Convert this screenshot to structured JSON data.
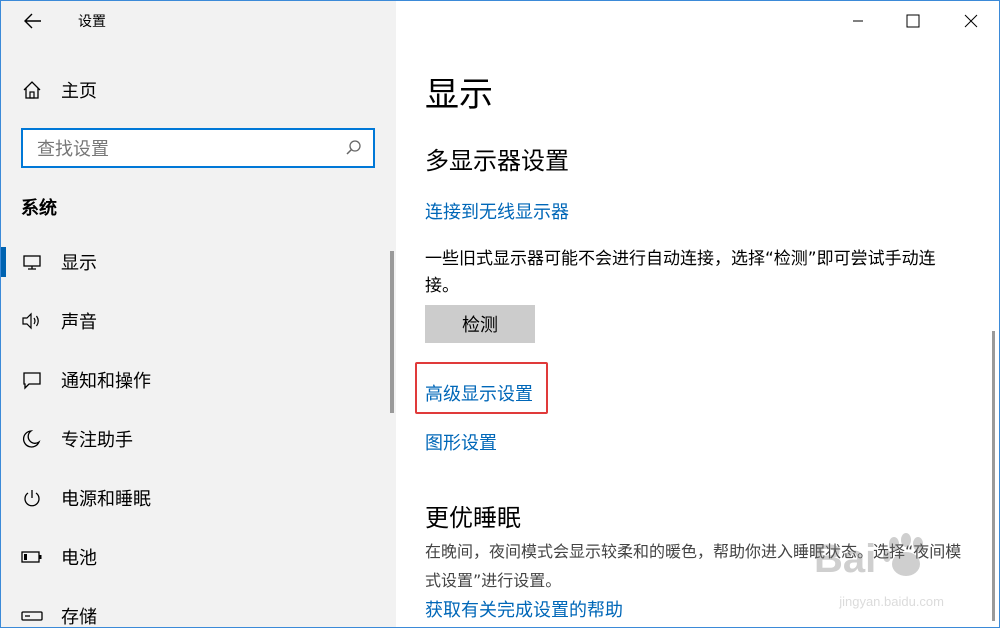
{
  "window": {
    "title": "设置"
  },
  "sidebar": {
    "home_label": "主页",
    "search_placeholder": "查找设置",
    "section_label": "系统",
    "items": [
      {
        "label": "显示",
        "icon": "monitor-icon",
        "selected": true
      },
      {
        "label": "声音",
        "icon": "speaker-icon"
      },
      {
        "label": "通知和操作",
        "icon": "notification-icon"
      },
      {
        "label": "专注助手",
        "icon": "moon-icon"
      },
      {
        "label": "电源和睡眠",
        "icon": "power-icon"
      },
      {
        "label": "电池",
        "icon": "battery-icon"
      },
      {
        "label": "存储",
        "icon": "storage-icon"
      }
    ]
  },
  "main": {
    "title": "显示",
    "multi_display": {
      "heading": "多显示器设置",
      "connect_link": "连接到无线显示器",
      "description": "一些旧式显示器可能不会进行自动连接，选择“检测”即可尝试手动连接。",
      "detect_button": "检测"
    },
    "advanced_link": "高级显示设置",
    "graphics_link": "图形设置",
    "sleep": {
      "heading": "更优睡眠",
      "description": "在晚间，夜间模式会显示较柔和的暖色，帮助你进入睡眠状态。选择“夜间模式设置”进行设置。",
      "help_link": "获取有关完成设置的帮助"
    }
  },
  "watermark": {
    "text": "jingyan.baidu.com"
  },
  "colors": {
    "accent": "#0078d7",
    "link": "#0067b8",
    "highlight": "#e03a3a"
  }
}
